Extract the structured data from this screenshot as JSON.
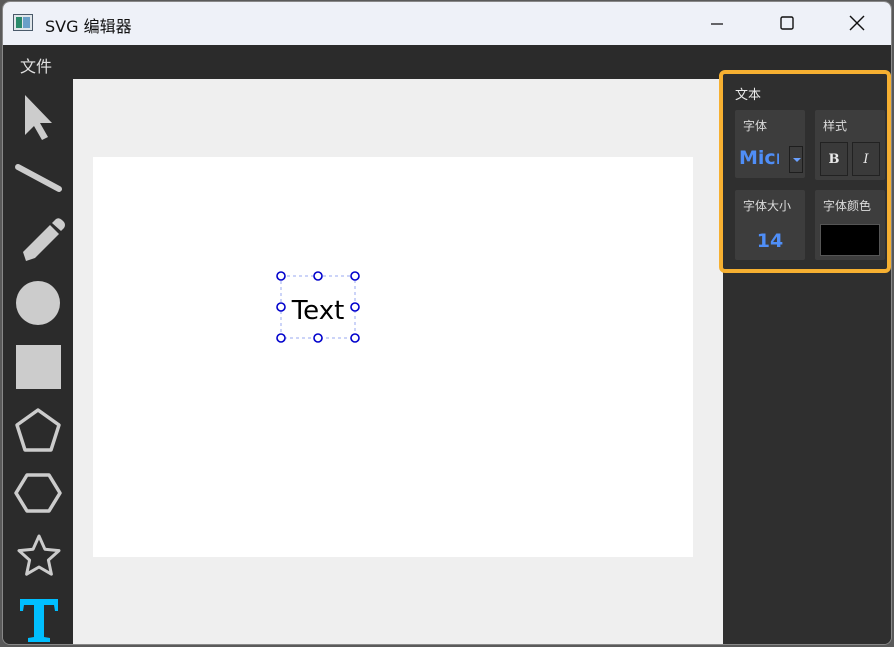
{
  "window": {
    "title": "SVG 编辑器"
  },
  "menu": {
    "file": "文件"
  },
  "toolbar": {
    "tools": [
      {
        "name": "select-tool",
        "icon": "cursor-arrow-icon"
      },
      {
        "name": "line-tool",
        "icon": "line-icon"
      },
      {
        "name": "pencil-tool",
        "icon": "pencil-icon"
      },
      {
        "name": "circle-tool",
        "icon": "circle-icon"
      },
      {
        "name": "rectangle-tool",
        "icon": "square-icon"
      },
      {
        "name": "pentagon-tool",
        "icon": "pentagon-icon"
      },
      {
        "name": "hexagon-tool",
        "icon": "hexagon-icon"
      },
      {
        "name": "star-tool",
        "icon": "star-icon"
      },
      {
        "name": "text-tool",
        "icon": "text-T-icon",
        "active": true
      }
    ]
  },
  "canvas": {
    "text_element": {
      "content": "Text",
      "font_size": 14,
      "color": "#000000",
      "selected": true
    }
  },
  "panel": {
    "title": "文本",
    "font": {
      "label": "字体",
      "value": "Micr"
    },
    "style": {
      "label": "样式",
      "bold": "B",
      "italic": "I"
    },
    "size": {
      "label": "字体大小",
      "value": "14"
    },
    "color": {
      "label": "字体颜色",
      "value": "#000000"
    }
  },
  "colors": {
    "accent_highlight": "#f6b031",
    "value_blue": "#4f8ef7",
    "text_tool_active": "#00bfff",
    "selection_handle": "#0000cc"
  }
}
